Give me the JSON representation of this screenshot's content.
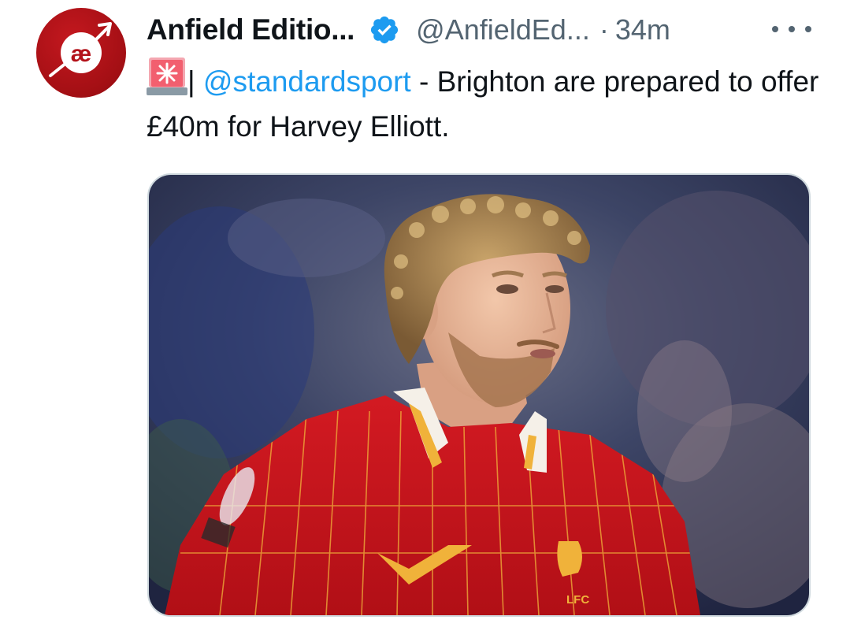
{
  "tweet": {
    "avatar_icon": "anfield-edition-logo-icon",
    "avatar_logo_text": "æ",
    "display_name": "Anfield Editio...",
    "verified_icon": "verified-badge-icon",
    "handle": "@AnfieldEd...",
    "separator": "·",
    "timestamp": "34m",
    "more_icon": "more-options-icon",
    "text": {
      "emoji_icon": "rotating-light-icon",
      "pipe": "|",
      "mention": "@standardsport",
      "body": " - Brighton are prepared to offer £40m for Harvey Elliott."
    },
    "media": {
      "type": "photo",
      "shirt_crest_text": "LFC"
    }
  },
  "colors": {
    "text_primary": "#0f1419",
    "text_secondary": "#536471",
    "link": "#1d9bf0",
    "verified": "#1d9bf0",
    "avatar_bg": "#b3121a",
    "shirt_red": "#c8141c"
  }
}
